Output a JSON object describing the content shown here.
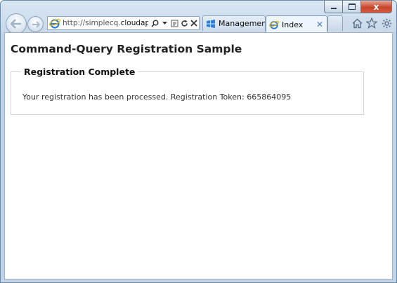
{
  "browser": {
    "address": {
      "url_prefix": "http://simplecq.",
      "url_host": "cloudapp...",
      "search_icon": "search-icon",
      "dropdown_icon": "chevron-down-icon",
      "compat_icon": "compatibility-view-icon",
      "refresh_icon": "refresh-icon",
      "stop_icon": "stop-icon"
    },
    "tabs": [
      {
        "label": "Managemen...",
        "icon": "azure-windows-icon"
      },
      {
        "label": "Index",
        "icon": "ie-icon",
        "close": "✕"
      }
    ],
    "caption": {
      "close": "x"
    },
    "accent": "#4a7fb5"
  },
  "page": {
    "title": "Command-Query Registration Sample",
    "section_legend": "Registration Complete",
    "message": "Your registration has been processed. Registration Token: 665864095"
  }
}
